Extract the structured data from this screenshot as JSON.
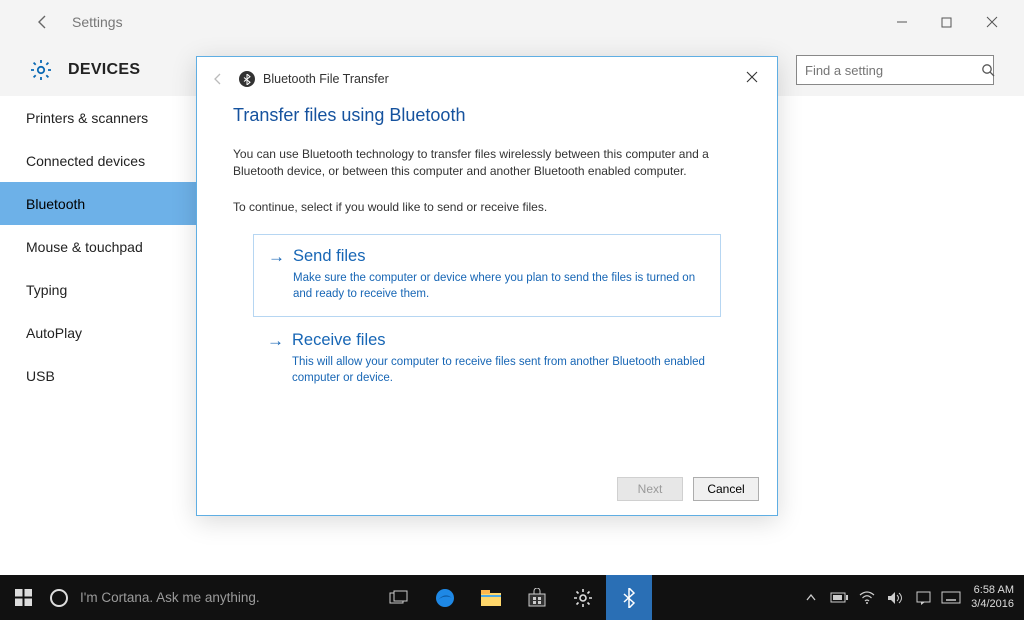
{
  "titlebar": {
    "title": "Settings"
  },
  "header": {
    "section": "DEVICES"
  },
  "search": {
    "placeholder": "Find a setting"
  },
  "sidebar": {
    "items": [
      {
        "label": "Printers & scanners"
      },
      {
        "label": "Connected devices"
      },
      {
        "label": "Bluetooth"
      },
      {
        "label": "Mouse & touchpad"
      },
      {
        "label": "Typing"
      },
      {
        "label": "AutoPlay"
      },
      {
        "label": "USB"
      }
    ]
  },
  "dialog": {
    "window_title": "Bluetooth File Transfer",
    "heading": "Transfer files using Bluetooth",
    "intro": "You can use Bluetooth technology to transfer files wirelessly between this computer and a Bluetooth device, or between this computer and another Bluetooth enabled computer.",
    "prompt": "To continue, select if you would like to send or receive files.",
    "send": {
      "title": "Send files",
      "desc": "Make sure the computer or device where you plan to send the files is turned on and ready to receive them."
    },
    "receive": {
      "title": "Receive files",
      "desc": "This will allow your computer to receive files sent from another Bluetooth enabled computer or device."
    },
    "buttons": {
      "next": "Next",
      "cancel": "Cancel"
    }
  },
  "taskbar": {
    "cortana": "I'm Cortana. Ask me anything.",
    "clock": {
      "time": "6:58 AM",
      "date": "3/4/2016"
    }
  }
}
